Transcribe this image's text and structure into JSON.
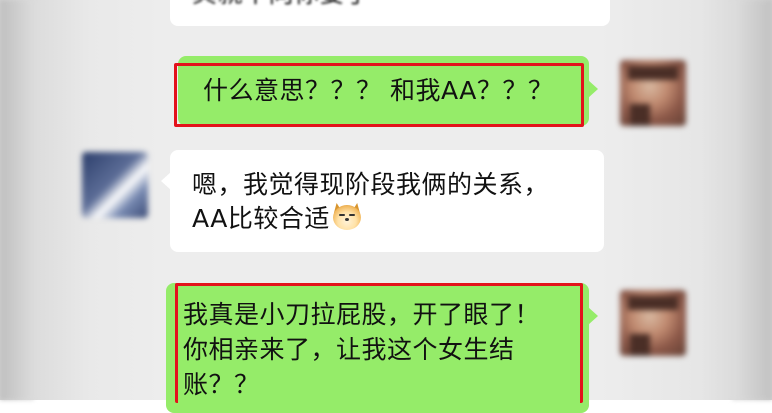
{
  "messages": [
    {
      "side": "left",
      "color": "white",
      "lines": [
        "其就不向你要了"
      ],
      "partial": true
    },
    {
      "side": "right",
      "color": "green",
      "lines": [
        "什么意思？？？ 和我AA？？？"
      ],
      "highlighted": true
    },
    {
      "side": "left",
      "color": "white",
      "lines": [
        "嗯，我觉得现阶段我俩的关系，",
        "AA比较合适"
      ],
      "emoji": "doge-emoji"
    },
    {
      "side": "right",
      "color": "green",
      "lines": [
        "我真是小刀拉屁股，开了眼了！",
        "你相亲来了，让我这个女生结",
        "账？？"
      ],
      "highlighted": true
    }
  ],
  "colors": {
    "self_bubble": "#95ec69",
    "other_bubble": "#ffffff",
    "highlight": "#e3121b",
    "background": "#ededed"
  },
  "icons": {
    "self_avatar": "avatar-blurred",
    "other_avatar": "avatar-blurred",
    "emoji": "doge-emoji"
  }
}
